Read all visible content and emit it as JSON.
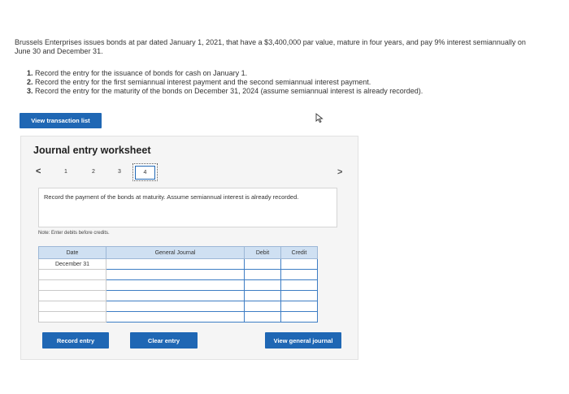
{
  "problem": {
    "text": "Brussels Enterprises issues bonds at par dated January 1, 2021, that have a $3,400,000 par value, mature in four years, and pay 9% interest semiannually on June 30 and December 31."
  },
  "requirements": [
    {
      "num": "1.",
      "text": "Record the entry for the issuance of bonds for cash on January 1."
    },
    {
      "num": "2.",
      "text": "Record the entry for the first semiannual interest payment and the second semiannual interest payment."
    },
    {
      "num": "3.",
      "text": "Record the entry for the maturity of the bonds on December 31, 2024 (assume semiannual interest is already recorded)."
    }
  ],
  "buttons": {
    "view_transaction_list": "View transaction list",
    "record_entry": "Record entry",
    "clear_entry": "Clear entry",
    "view_general_journal": "View general journal"
  },
  "worksheet": {
    "title": "Journal entry worksheet",
    "nav_prev": "<",
    "nav_next": ">",
    "tabs": [
      "1",
      "2",
      "3",
      "4"
    ],
    "active_tab": "4",
    "instruction": "Record the payment of the bonds at maturity. Assume semiannual interest is already recorded.",
    "note": "Note: Enter debits before credits."
  },
  "journal": {
    "headers": {
      "date": "Date",
      "general_journal": "General Journal",
      "debit": "Debit",
      "credit": "Credit"
    },
    "rows": [
      {
        "date": "December 31",
        "account": "",
        "debit": "",
        "credit": ""
      },
      {
        "date": "",
        "account": "",
        "debit": "",
        "credit": ""
      },
      {
        "date": "",
        "account": "",
        "debit": "",
        "credit": ""
      },
      {
        "date": "",
        "account": "",
        "debit": "",
        "credit": ""
      },
      {
        "date": "",
        "account": "",
        "debit": "",
        "credit": ""
      },
      {
        "date": "",
        "account": "",
        "debit": "",
        "credit": ""
      }
    ]
  },
  "colors": {
    "button_blue": "#1f67b4",
    "header_blue": "#cfe0f2",
    "input_border": "#3d7dc4",
    "worksheet_bg": "#f5f5f5"
  }
}
